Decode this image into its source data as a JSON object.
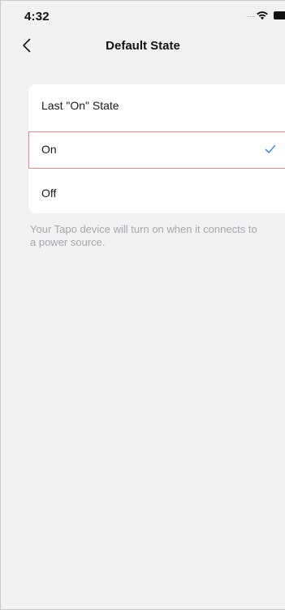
{
  "status_bar": {
    "time": "4:32",
    "signal_dots": "....."
  },
  "nav": {
    "title": "Default State",
    "back_icon": "chevron-left-icon"
  },
  "options": [
    {
      "label": "Last \"On\" State",
      "selected": false
    },
    {
      "label": "On",
      "selected": true
    },
    {
      "label": "Off",
      "selected": false
    }
  ],
  "hint": "Your Tapo device will turn on when it connects to a power source.",
  "colors": {
    "background": "#f2f2f5",
    "card": "#ffffff",
    "selected_border": "#e8888a",
    "check": "#4a90e2",
    "hint": "#a6a6ab"
  },
  "icons": {
    "wifi": "wifi-icon",
    "battery": "battery-icon",
    "check": "check-icon"
  }
}
